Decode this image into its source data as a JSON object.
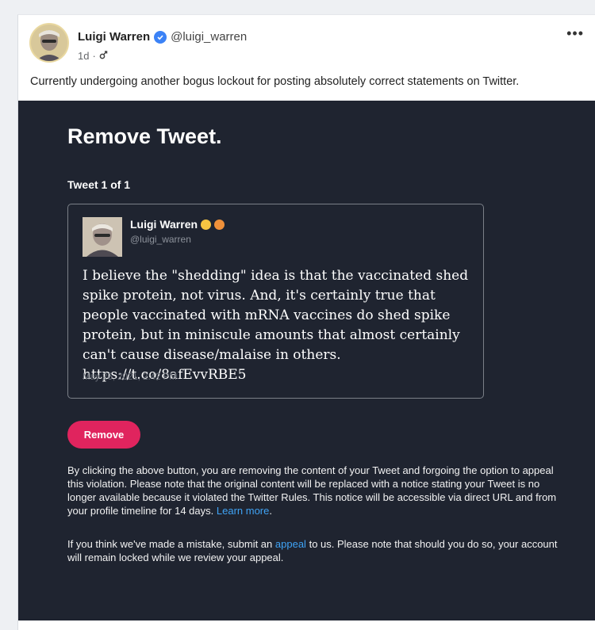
{
  "post": {
    "author_name": "Luigi Warren",
    "handle": "@luigi_warren",
    "age": "1d",
    "separator": "·",
    "text": "Currently undergoing another bogus lockout for posting absolutely correct statements on Twitter.",
    "icons": [
      "verified-badge-icon",
      "audience-icon",
      "more-options-icon"
    ]
  },
  "screenshot": {
    "title": "Remove Tweet.",
    "tweet_count": "Tweet 1 of 1",
    "tweet": {
      "name": "Luigi Warren",
      "handle": "@luigi_warren",
      "emojis": [
        "smile-emoji-icon",
        "cat-emoji-icon"
      ],
      "body": "I believe the \"shedding\" idea is that the vaccinated shed spike protein, not virus. And, it's certainly true that people vaccinated with mRNA vaccines do shed spike protein, but in miniscule amounts that almost certainly can't cause disease/malaise in others. https://t.co/8afEvvRBE5",
      "date": "May 26, 2021, 2:42 PM"
    },
    "remove_button": "Remove",
    "notice": "By clicking the above button, you are removing the content of your Tweet and forgoing the option to appeal this violation. Please note that the original content will be replaced with a notice stating your Tweet is no longer available because it violated the Twitter Rules. This notice will be accessible via direct URL and from your profile timeline for 14 days.",
    "learn_more": "Learn more",
    "notice_end": ".",
    "appeal_pre": "If you think we've made a mistake, submit an",
    "appeal_link": "appeal",
    "appeal_post": "to us. Please note that should you do so, your account will remain locked while we review your appeal."
  },
  "colors": {
    "dark_bg": "#1f2430",
    "accent_red": "#e0245e",
    "link_blue": "#3fa3f5",
    "verified_blue": "#3b82f6"
  }
}
